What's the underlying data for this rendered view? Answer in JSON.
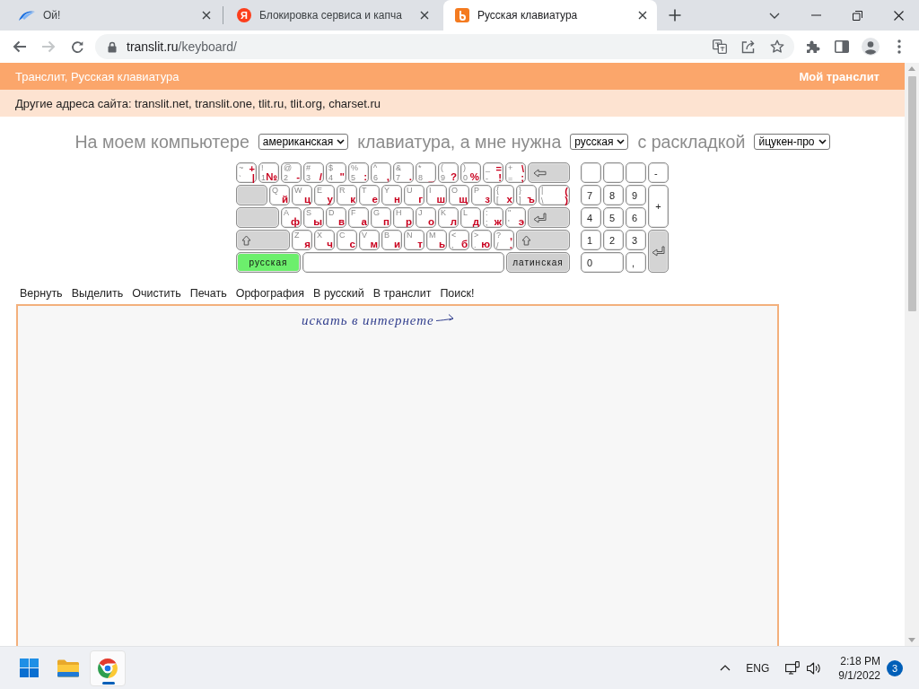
{
  "browser": {
    "tabs": [
      {
        "kind": "swoosh",
        "title": "Ой!",
        "selected": false
      },
      {
        "kind": "letter",
        "logo_letter": "Я",
        "title": "Блокировка сервиса и капча",
        "selected": false
      },
      {
        "kind": "square",
        "title": "Русская клавиатура",
        "selected": true
      }
    ],
    "forward_disabled": true,
    "address": {
      "host": "translit.ru",
      "path": "/keyboard/"
    }
  },
  "site_bar": {
    "title": "Транслит, Русская клавиатура",
    "link": "Мой транслит"
  },
  "other_addresses": "Другие адреса сайта: translit.net, translit.one, tlit.ru, tlit.org, charset.ru",
  "setup_line": [
    {
      "kind": "text",
      "text": "На моем компьютере"
    },
    {
      "kind": "select",
      "value": "американская"
    },
    {
      "kind": "text",
      "text": "клавиатура, а мне нужна"
    },
    {
      "kind": "select",
      "value": "русская"
    },
    {
      "kind": "text",
      "text": "с раскладкой"
    },
    {
      "kind": "select",
      "value": "йцукен-про"
    }
  ],
  "keyboard": {
    "rows": [
      {
        "keys": [
          {
            "kind": "char",
            "latin_upper": "~",
            "latin_lower": "`",
            "ru_upper": "+",
            "ru_lower": "|"
          },
          {
            "kind": "char",
            "latin_upper": "!",
            "latin_lower": "1",
            "ru_lower": "№"
          },
          {
            "kind": "char",
            "latin_upper": "@",
            "latin_lower": "2",
            "ru_lower": "-"
          },
          {
            "kind": "char",
            "latin_upper": "#",
            "latin_lower": "3",
            "ru_lower": "/"
          },
          {
            "kind": "char",
            "latin_upper": "$",
            "latin_lower": "4",
            "ru_lower": "\""
          },
          {
            "kind": "char",
            "latin_upper": "%",
            "latin_lower": "5",
            "ru_lower": ":"
          },
          {
            "kind": "char",
            "latin_upper": "^",
            "latin_lower": "6",
            "ru_lower": ","
          },
          {
            "kind": "char",
            "latin_upper": "&",
            "latin_lower": "7",
            "ru_lower": "."
          },
          {
            "kind": "char",
            "latin_upper": "*",
            "latin_lower": "8",
            "ru_lower": "_"
          },
          {
            "kind": "char",
            "latin_upper": "(",
            "latin_lower": "9",
            "ru_lower": "?"
          },
          {
            "kind": "char",
            "latin_upper": ")",
            "latin_lower": "0",
            "ru_lower": "%"
          },
          {
            "kind": "char",
            "latin_upper": "_",
            "latin_lower": "-",
            "ru_upper": "=",
            "ru_lower": "!"
          },
          {
            "kind": "char",
            "latin_upper": "+",
            "latin_lower": "=",
            "ru_upper": "\\",
            "ru_lower": ";"
          },
          {
            "kind": "backspace"
          }
        ]
      },
      {
        "keys": [
          {
            "kind": "tab"
          },
          {
            "kind": "char",
            "latin_upper": "Q",
            "ru_lower": "й"
          },
          {
            "kind": "char",
            "latin_upper": "W",
            "ru_lower": "ц"
          },
          {
            "kind": "char",
            "latin_upper": "E",
            "ru_lower": "у"
          },
          {
            "kind": "char",
            "latin_upper": "R",
            "ru_lower": "к"
          },
          {
            "kind": "char",
            "latin_upper": "T",
            "ru_lower": "е"
          },
          {
            "kind": "char",
            "latin_upper": "Y",
            "ru_lower": "н"
          },
          {
            "kind": "char",
            "latin_upper": "U",
            "ru_lower": "г"
          },
          {
            "kind": "char",
            "latin_upper": "I",
            "ru_lower": "ш"
          },
          {
            "kind": "char",
            "latin_upper": "O",
            "ru_lower": "щ"
          },
          {
            "kind": "char",
            "latin_upper": "P",
            "ru_lower": "з"
          },
          {
            "kind": "char",
            "latin_upper": "{",
            "latin_lower": "[",
            "ru_lower": "х"
          },
          {
            "kind": "char",
            "latin_upper": "}",
            "latin_lower": "]",
            "ru_lower": "ъ"
          },
          {
            "kind": "char",
            "latin_upper": "|",
            "latin_lower": "\\",
            "ru_upper": "(",
            "ru_lower": ")"
          }
        ]
      },
      {
        "keys": [
          {
            "kind": "caps"
          },
          {
            "kind": "char",
            "latin_upper": "A",
            "ru_lower": "ф"
          },
          {
            "kind": "char",
            "latin_upper": "S",
            "ru_lower": "ы"
          },
          {
            "kind": "char",
            "latin_upper": "D",
            "ru_lower": "в"
          },
          {
            "kind": "char",
            "latin_upper": "F",
            "ru_lower": "а"
          },
          {
            "kind": "char",
            "latin_upper": "G",
            "ru_lower": "п"
          },
          {
            "kind": "char",
            "latin_upper": "H",
            "ru_lower": "р"
          },
          {
            "kind": "char",
            "latin_upper": "J",
            "ru_lower": "о"
          },
          {
            "kind": "char",
            "latin_upper": "K",
            "ru_lower": "л"
          },
          {
            "kind": "char",
            "latin_upper": "L",
            "ru_lower": "д"
          },
          {
            "kind": "char",
            "latin_upper": ":",
            "latin_lower": ";",
            "ru_lower": "ж"
          },
          {
            "kind": "char",
            "latin_upper": "\"",
            "latin_lower": "'",
            "ru_lower": "э"
          },
          {
            "kind": "enter"
          }
        ]
      },
      {
        "keys": [
          {
            "kind": "shift"
          },
          {
            "kind": "char",
            "latin_upper": "Z",
            "ru_lower": "я"
          },
          {
            "kind": "char",
            "latin_upper": "X",
            "ru_lower": "ч"
          },
          {
            "kind": "char",
            "latin_upper": "C",
            "ru_lower": "с"
          },
          {
            "kind": "char",
            "latin_upper": "V",
            "ru_lower": "м"
          },
          {
            "kind": "char",
            "latin_upper": "B",
            "ru_lower": "и"
          },
          {
            "kind": "char",
            "latin_upper": "N",
            "ru_lower": "т"
          },
          {
            "kind": "char",
            "latin_upper": "M",
            "ru_lower": "ь"
          },
          {
            "kind": "char",
            "latin_upper": "<",
            "latin_lower": ",",
            "ru_lower": "б"
          },
          {
            "kind": "char",
            "latin_upper": ">",
            "latin_lower": ".",
            "ru_lower": "ю"
          },
          {
            "kind": "char",
            "latin_upper": "?",
            "latin_lower": "/",
            "ru_upper": ",",
            "ru_lower": "."
          },
          {
            "kind": "shift"
          }
        ]
      },
      {
        "keys": [
          {
            "kind": "layout",
            "label": "русская",
            "selected": true
          },
          {
            "kind": "space"
          },
          {
            "kind": "layout",
            "label": "латинская",
            "selected": false
          }
        ]
      }
    ]
  },
  "numpad": [
    {
      "kind": "blank"
    },
    {
      "kind": "blank"
    },
    {
      "kind": "blank"
    },
    {
      "kind": "key",
      "label": "-"
    },
    {
      "kind": "key",
      "label": "7"
    },
    {
      "kind": "key",
      "label": "8"
    },
    {
      "kind": "key",
      "label": "9"
    },
    {
      "kind": "tall",
      "label": "+"
    },
    {
      "kind": "key",
      "label": "4"
    },
    {
      "kind": "key",
      "label": "5"
    },
    {
      "kind": "key",
      "label": "6"
    },
    {
      "kind": "key",
      "label": "1"
    },
    {
      "kind": "key",
      "label": "2"
    },
    {
      "kind": "key",
      "label": "3"
    },
    {
      "kind": "enter"
    },
    {
      "kind": "wide",
      "label": "0"
    },
    {
      "kind": "key",
      "label": ","
    }
  ],
  "toolbar": [
    "Вернуть",
    "Выделить",
    "Очистить",
    "Печать",
    "Орфография",
    "В русский",
    "В транслит",
    "Поиск!"
  ],
  "editor": {
    "hint": "искать в интернете"
  },
  "taskbar": {
    "language": "ENG",
    "time": "2:18 PM",
    "date": "9/1/2022",
    "notifications": "3"
  }
}
